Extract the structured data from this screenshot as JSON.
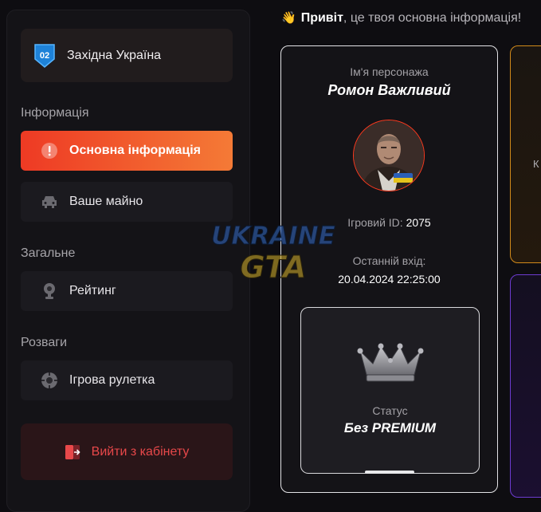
{
  "sidebar": {
    "server": {
      "badge": "02",
      "name": "Західна Україна"
    },
    "sections": {
      "info": "Інформація",
      "general": "Загальне",
      "fun": "Розваги"
    },
    "items": [
      {
        "label": "Основна інформація",
        "icon": "alert-circle-icon",
        "active": true
      },
      {
        "label": "Ваше майно",
        "icon": "car-icon",
        "active": false
      },
      {
        "label": "Рейтинг",
        "icon": "trophy-icon",
        "active": false
      },
      {
        "label": "Ігрова рулетка",
        "icon": "roulette-icon",
        "active": false
      }
    ],
    "logout_label": "Вийти з кабінету"
  },
  "greeting": {
    "emoji": "👋",
    "hello": "Привіт",
    "rest": ", це твоя основна інформація!"
  },
  "profile": {
    "name_label": "Ім'я персонажа",
    "name": "Ромон Важливий",
    "id_label": "Ігровий ID:",
    "id_value": "2075",
    "last_login_label": "Останній вхід:",
    "last_login_value": "20.04.2024 22:25:00",
    "status_label": "Статус",
    "status_value": "Без PREMIUM"
  },
  "side_card_fragment": "К",
  "watermark": {
    "line1": "UKRAINE",
    "line2": "GTA"
  },
  "colors": {
    "accent_start": "#ee3a24",
    "accent_end": "#f47a36",
    "logout_text": "#e8484a",
    "card_gold": "#d28a1a",
    "card_purple": "#6d3bd1"
  }
}
